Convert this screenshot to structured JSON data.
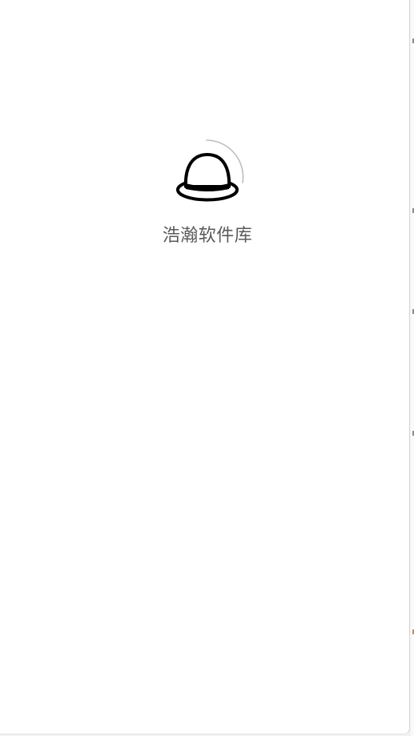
{
  "splash": {
    "app_name": "浩瀚软件库",
    "logo_icon": "bowler-hat-icon",
    "loading_indicator": "spinner-arc"
  },
  "colors": {
    "background": "#ffffff",
    "text": "#5a5a5a",
    "logo": "#000000",
    "spinner": "#bdbdbd"
  }
}
